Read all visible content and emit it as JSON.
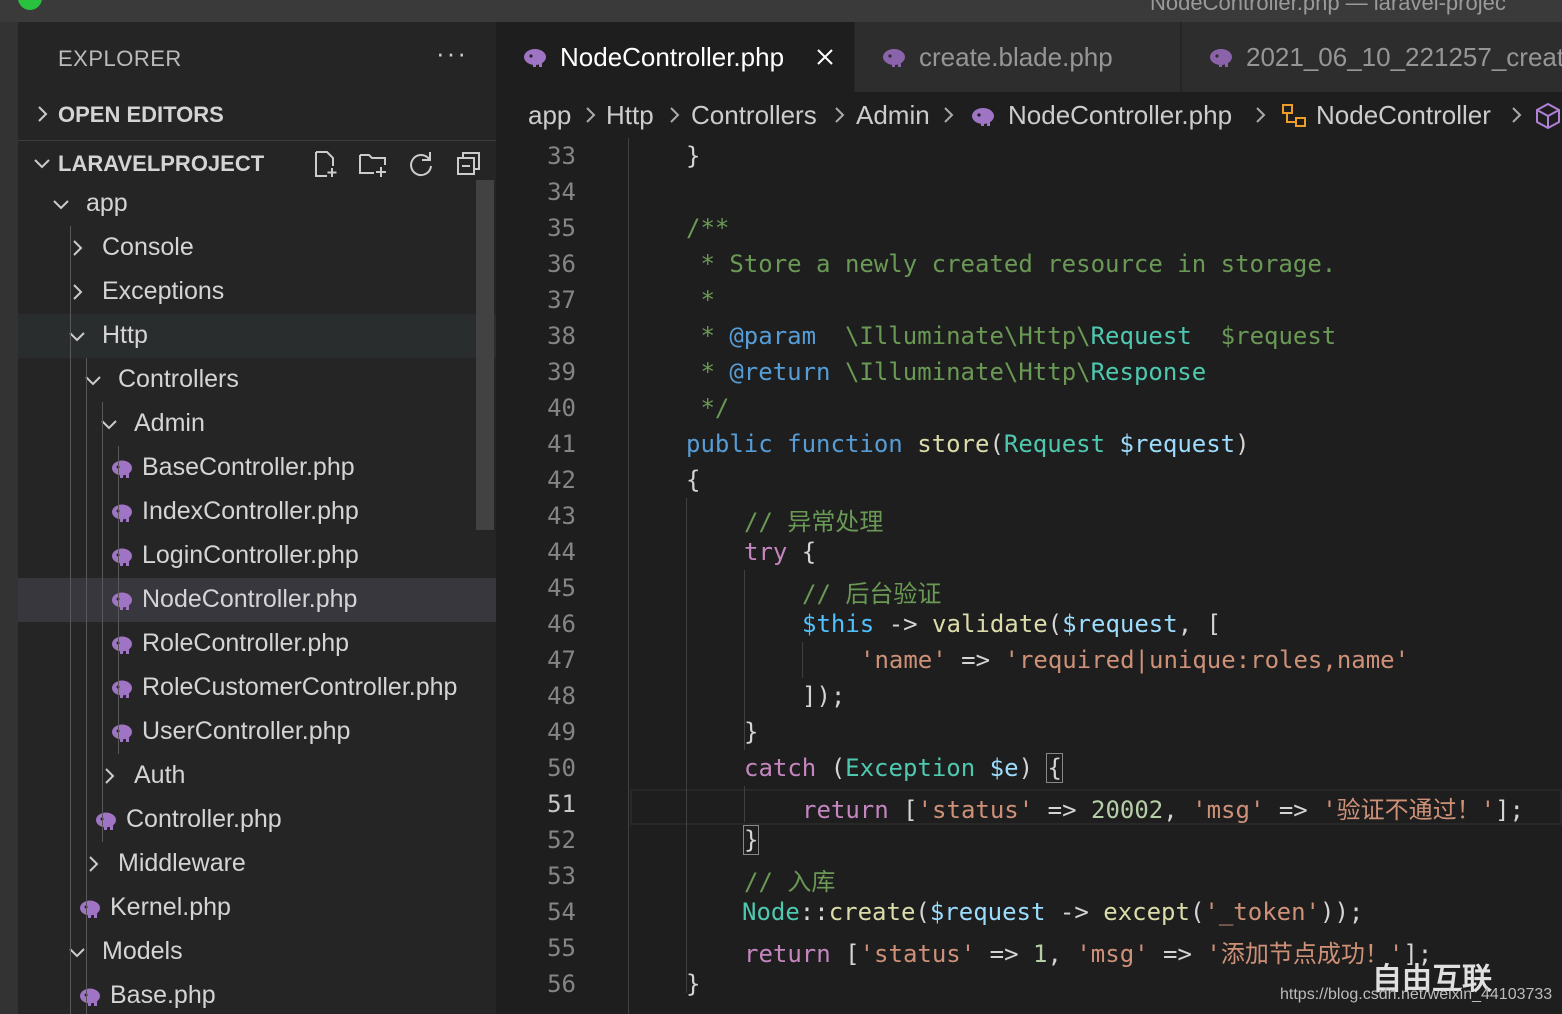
{
  "window": {
    "title_fragment": "NodeController.php — laravel-projec"
  },
  "sidebar": {
    "header": "EXPLORER",
    "more": "···",
    "open_editors": "OPEN EDITORS",
    "project": "LARAVELPROJECT",
    "tree": [
      {
        "label": "app",
        "kind": "folder-open"
      },
      {
        "label": "Console",
        "kind": "folder-closed"
      },
      {
        "label": "Exceptions",
        "kind": "folder-closed"
      },
      {
        "label": "Http",
        "kind": "folder-open"
      },
      {
        "label": "Controllers",
        "kind": "folder-open"
      },
      {
        "label": "Admin",
        "kind": "folder-open"
      },
      {
        "label": "BaseController.php",
        "kind": "php"
      },
      {
        "label": "IndexController.php",
        "kind": "php"
      },
      {
        "label": "LoginController.php",
        "kind": "php"
      },
      {
        "label": "NodeController.php",
        "kind": "php"
      },
      {
        "label": "RoleController.php",
        "kind": "php"
      },
      {
        "label": "RoleCustomerController.php",
        "kind": "php"
      },
      {
        "label": "UserController.php",
        "kind": "php"
      },
      {
        "label": "Auth",
        "kind": "folder-closed"
      },
      {
        "label": "Controller.php",
        "kind": "php"
      },
      {
        "label": "Middleware",
        "kind": "folder-closed"
      },
      {
        "label": "Kernel.php",
        "kind": "php"
      },
      {
        "label": "Models",
        "kind": "folder-open"
      },
      {
        "label": "Base.php",
        "kind": "php"
      }
    ]
  },
  "tabs": [
    {
      "label": "NodeController.php",
      "active": true
    },
    {
      "label": "create.blade.php",
      "active": false
    },
    {
      "label": "2021_06_10_221257_creat",
      "active": false
    }
  ],
  "breadcrumb": [
    "app",
    "Http",
    "Controllers",
    "Admin",
    "NodeController.php",
    "NodeController"
  ],
  "editor": {
    "line_numbers": [
      "33",
      "34",
      "35",
      "36",
      "37",
      "38",
      "39",
      "40",
      "41",
      "42",
      "43",
      "44",
      "45",
      "46",
      "47",
      "48",
      "49",
      "50",
      "51",
      "52",
      "53",
      "54",
      "55",
      "56"
    ],
    "current_line": "51",
    "code": {
      "l33": "}",
      "l35": "/**",
      "l36": " * Store a newly created resource in storage.",
      "l37": " *",
      "l38_star": " * ",
      "l38_tag": "@param",
      "l38_ns": "  \\Illuminate\\Http\\",
      "l38_cls": "Request",
      "l38_var": "  $request",
      "l39_star": " * ",
      "l39_tag": "@return",
      "l39_ns": " \\Illuminate\\Http\\",
      "l39_cls": "Response",
      "l40": " */",
      "l41_kw1": "public",
      "l41_kw2": "function",
      "l41_fn": "store",
      "l41_cls": "Request",
      "l41_var": "$request",
      "l42": "{",
      "l43": "// 异常处理",
      "l44_kw": "try",
      "l44_p": " {",
      "l45": "// 后台验证",
      "l46_this": "$this",
      "l46_op": " -> ",
      "l46_fn": "validate",
      "l46_var": "$request",
      "l46_tail": ", [",
      "l47_key": "'name'",
      "l47_op": " => ",
      "l47_val": "'required|unique:roles,name'",
      "l48": "]);",
      "l49": "}",
      "l50_kw": "catch",
      "l50_cls": "Exception",
      "l50_var": "$e",
      "l51_kw": "return",
      "l51_k1": "'status'",
      "l51_num": "20002",
      "l51_k2": "'msg'",
      "l51_msg": "'验证不通过！'",
      "l52": "}",
      "l53": "// 入库",
      "l54_cls": "Node",
      "l54_fn": "create",
      "l54_var": "$request",
      "l54_fn2": "except",
      "l54_str": "'_token'",
      "l55_kw": "return",
      "l55_k1": "'status'",
      "l55_num": "1",
      "l55_k2": "'msg'",
      "l55_msg": "'添加节点成功！'",
      "l56": "}"
    }
  },
  "watermark": {
    "logo": "自由互联",
    "url": "https://blog.csdn.net/weixin_44103733"
  }
}
